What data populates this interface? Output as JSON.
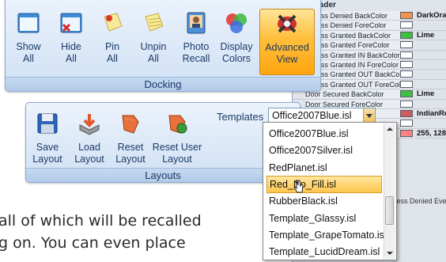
{
  "promo": {
    "line1": "all of which will be recalled",
    "line2": "g on.  You can even place"
  },
  "property_grid": {
    "category": "Reader",
    "expander": "⊟",
    "rows": [
      {
        "name": "Access Denied BackColor",
        "color": "#f4914a",
        "value": "DarkOrange"
      },
      {
        "name": "Access Denied ForeColor",
        "color": "#ffffff",
        "value": ""
      },
      {
        "name": "Access Granted BackColor",
        "color": "#3fbf3f",
        "value": "Lime"
      },
      {
        "name": "Access Granted ForeColor",
        "color": "#ffffff",
        "value": ""
      },
      {
        "name": "Access Granted IN BackColor",
        "color": "#ffffff",
        "value": ""
      },
      {
        "name": "Access Granted IN ForeColor",
        "color": "#ffffff",
        "value": ""
      },
      {
        "name": "Access Granted OUT BackColor",
        "color": "#ffffff",
        "value": ""
      },
      {
        "name": "Access Granted OUT ForeColor",
        "color": "#ffffff",
        "value": ""
      },
      {
        "name": "Door Secured BackColor",
        "color": "#3fbf3f",
        "value": "Lime"
      },
      {
        "name": "Door Secured ForeColor",
        "color": "#ffffff",
        "value": ""
      },
      {
        "name": "m BackC",
        "color": "#cd5c5c",
        "value": "IndianRed"
      },
      {
        "name": "m ForeC",
        "color": "#ffffff",
        "value": ""
      },
      {
        "name": "",
        "color": "#ff8080",
        "value": "255, 128, 128"
      }
    ],
    "footer_text": "cess Denied Event"
  },
  "docking": {
    "title": "Docking",
    "buttons": [
      {
        "line1": "Show",
        "line2": "All",
        "icon": "show-all-icon"
      },
      {
        "line1": "Hide",
        "line2": "All",
        "icon": "hide-all-icon"
      },
      {
        "line1": "Pin",
        "line2": "All",
        "icon": "pin-icon"
      },
      {
        "line1": "Unpin",
        "line2": "All",
        "icon": "unpin-icon"
      },
      {
        "line1": "Photo",
        "line2": "Recall",
        "icon": "photo-icon"
      },
      {
        "line1": "Display",
        "line2": "Colors",
        "icon": "colors-icon"
      },
      {
        "line1": "Advanced",
        "line2": "View",
        "icon": "advanced-view-icon",
        "active": true
      }
    ]
  },
  "layouts": {
    "title": "Layouts",
    "buttons": [
      {
        "line1": "Save",
        "line2": "Layout",
        "icon": "save-icon"
      },
      {
        "line1": "Load",
        "line2": "Layout",
        "icon": "load-icon"
      },
      {
        "line1": "Reset",
        "line2": "Layout",
        "icon": "reset-icon"
      },
      {
        "line1": "Reset User",
        "line2": "Layout",
        "icon": "reset-user-icon"
      }
    ],
    "templates_label": "Templates",
    "selected_template": "Office2007Blue.isl"
  },
  "dropdown": {
    "options": [
      "Office2007Blue.isl",
      "Office2007Silver.isl",
      "RedPlanet.isl",
      "Red_No_Fill.isl",
      "RubberBlack.isl",
      "Template_Glassy.isl",
      "Template_GrapeTomato.isl",
      "Template_LucidDream.isl"
    ],
    "highlighted": "Red_No_Fill.isl"
  },
  "colors": {
    "accent": "#1c3a66",
    "highlight": "#ffc64d"
  }
}
